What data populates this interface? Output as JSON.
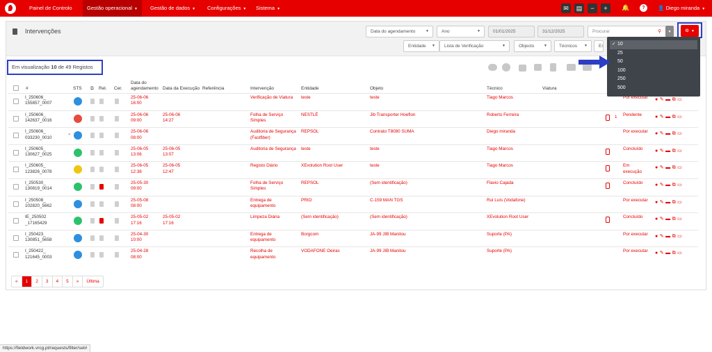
{
  "nav": {
    "items": [
      {
        "label": "Painel de Controlo",
        "caret": false,
        "active": false
      },
      {
        "label": "Gestão operacional",
        "caret": true,
        "active": true
      },
      {
        "label": "Gestão de dados",
        "caret": true,
        "active": false
      },
      {
        "label": "Configurações",
        "caret": true,
        "active": false
      },
      {
        "label": "Sistema",
        "caret": true,
        "active": false
      }
    ],
    "user": "Diego miranda",
    "caret": "▼",
    "help": "?"
  },
  "page": {
    "title": "Intervenções",
    "date_type": "Data do agendamento",
    "period": "Ano",
    "date_from": "01/01/2025",
    "date_to": "31/12/2025",
    "search_placeholder": "Procurar",
    "filters": [
      "Entidade",
      "Lista de Verificação",
      "Objecto",
      "Técnicos",
      "Es"
    ]
  },
  "page_size_menu": {
    "options": [
      "10",
      "25",
      "50",
      "100",
      "250",
      "500"
    ],
    "selected": "10"
  },
  "viewing": {
    "prefix": "Em visualização",
    "shown": "10",
    "middle": "de",
    "total": "49",
    "suffix": "Registos"
  },
  "columns": {
    "num": "#",
    "sts": "STS",
    "rel": "Rel.",
    "cer": "Cer.",
    "sched": "Data do agendamento",
    "exec": "Data da Execução",
    "ref": "Referência",
    "interv": "Intervenção",
    "entity": "Entidade",
    "object": "Objeto",
    "tech": "Técnico",
    "vehicle": "Viatura"
  },
  "rows": [
    {
      "id": "I_250606_ 155857_0007",
      "sts": "#2d8fdf",
      "rel_red": false,
      "sched": "25-06-06 16:00",
      "exec": "",
      "interv": "Verificação de Viatura",
      "entity": "teste",
      "object": "teste",
      "tech": "Tiago Marcos",
      "phone": false,
      "count": "",
      "status": "Por executar",
      "chevron": false
    },
    {
      "id": "I_250606_ 142637_0016",
      "sts": "#e84a3c",
      "rel_red": false,
      "sched": "25-06-06 09:00",
      "exec": "25-06-06 14:27",
      "interv": "Folha de Serviço Simples",
      "entity": "NESTLÉ",
      "object": "Jib Transporter Hoeflon",
      "tech": "Roberto Ferreira",
      "phone": true,
      "count": "1",
      "status": "Pendente",
      "chevron": false
    },
    {
      "id": "I_250606_ 033230_0010",
      "sts": "#2d8fdf",
      "rel_red": false,
      "sched": "25-06-06 08:00",
      "exec": "",
      "interv": "Auditoria de Segurança (Fastfiber)",
      "entity": "REPSOL",
      "object": "Contrato T8080 SUMA",
      "tech": "Diego miranda",
      "phone": false,
      "count": "",
      "status": "Por executar",
      "chevron": true
    },
    {
      "id": "I_250605_ 130627_0025",
      "sts": "#2cc26b",
      "rel_red": false,
      "sched": "25-06-05 13:06",
      "exec": "25-06-05 13:07",
      "interv": "Auditoria de Segurança",
      "entity": "teste",
      "object": "teste",
      "tech": "Tiago Marcos",
      "phone": true,
      "count": "",
      "status": "Concluído",
      "chevron": false
    },
    {
      "id": "I_250605_ 123826_0078",
      "sts": "#f1c40f",
      "rel_red": false,
      "sched": "25-06-05 12:38",
      "exec": "25-06-05 12:47",
      "interv": "Registo Diário",
      "entity": "XEvolution Root User",
      "object": "teste",
      "tech": "Tiago Marcos",
      "phone": true,
      "count": "",
      "status": "Em execução",
      "chevron": false
    },
    {
      "id": "I_250530_ 130819_0014",
      "sts": "#2cc26b",
      "rel_red": true,
      "sched": "25-05-30 09:00",
      "exec": "",
      "interv": "Folha de Serviço Simples",
      "entity": "REPSOL",
      "object": "(Sem identificação)",
      "tech": "Flavio Cajada",
      "phone": true,
      "count": "",
      "status": "Concluído",
      "chevron": false
    },
    {
      "id": "I_250508_ 102820_5662",
      "sts": "#2d8fdf",
      "rel_red": false,
      "sched": "25-05-08 08:00",
      "exec": "",
      "interv": "Entrega de equipamento",
      "entity": "PRIO",
      "object": "C-159 MAN TGS",
      "tech": "Rui Luís (Vodafone)",
      "phone": false,
      "count": "",
      "status": "Por executar",
      "chevron": false
    },
    {
      "id": "IE_250502 _17165429",
      "sts": "#2cc26b",
      "rel_red": true,
      "sched": "25-05-02 17:16",
      "exec": "25-05-02 17:16",
      "interv": "Limpeza Diária",
      "entity": "(Sem identificação)",
      "object": "(Sem identificação)",
      "tech": "XEvolution Root User",
      "phone": true,
      "count": "",
      "status": "Concluído",
      "chevron": false
    },
    {
      "id": "I_250423_ 130851_5658",
      "sts": "#2d8fdf",
      "rel_red": false,
      "sched": "25-04-30 10:00",
      "exec": "",
      "interv": "Entrega de equipamento",
      "entity": "Borgcom",
      "object": "JA-99 JIB Manitou",
      "tech": "Suporte (PA)",
      "phone": false,
      "count": "",
      "status": "Por executar",
      "chevron": false
    },
    {
      "id": "I_250422_ 121645_0003",
      "sts": "#2d8fdf",
      "rel_red": false,
      "sched": "25-04-28 08:00",
      "exec": "",
      "interv": "Recolha de equipamento",
      "entity": "VODAFONE Oeiras",
      "object": "JA-99 JIB Manitou",
      "tech": "Suporte (PA)",
      "phone": false,
      "count": "",
      "status": "Por executar",
      "chevron": false
    }
  ],
  "pagination": [
    "«",
    "1",
    "2",
    "3",
    "4",
    "5",
    "»",
    "Última"
  ],
  "status_url": "https://fieldwork.vrcg.pt/requests/filter/set#"
}
